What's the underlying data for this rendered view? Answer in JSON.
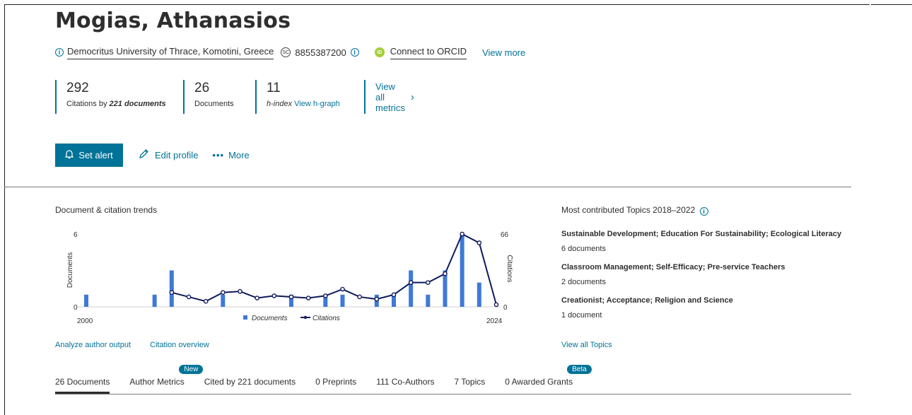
{
  "author": {
    "name": "Mogias, Athanasios",
    "affiliation": "Democritus University of Thrace, Komotini, Greece",
    "scopus_id": "8855387200",
    "orcid_label": "Connect to ORCID",
    "view_more": "View more"
  },
  "metrics": {
    "citations_value": "292",
    "citations_label_prefix": "Citations by ",
    "citations_label_bold": "221 documents",
    "documents_value": "26",
    "documents_label": "Documents",
    "hindex_value": "11",
    "hindex_label": "h-index",
    "hindex_link": "View h-graph",
    "view_all": "View all metrics"
  },
  "actions": {
    "set_alert": "Set alert",
    "edit_profile": "Edit profile",
    "more": "More"
  },
  "trends": {
    "title": "Document & citation trends",
    "analyze_link": "Analyze author output",
    "overview_link": "Citation overview"
  },
  "chart_data": {
    "type": "bar",
    "x": [
      2000,
      2001,
      2002,
      2003,
      2004,
      2005,
      2006,
      2007,
      2008,
      2009,
      2010,
      2011,
      2012,
      2013,
      2014,
      2015,
      2016,
      2017,
      2018,
      2019,
      2020,
      2021,
      2022,
      2023,
      2024
    ],
    "series": [
      {
        "name": "Documents",
        "axis": "left",
        "type": "bar",
        "values": [
          1,
          0,
          0,
          0,
          1,
          3,
          0,
          0,
          1,
          0,
          0,
          0,
          1,
          0,
          1,
          1,
          0,
          1,
          1,
          3,
          1,
          3,
          6,
          2,
          0
        ]
      },
      {
        "name": "Citations",
        "axis": "right",
        "type": "line",
        "start_year": 2005,
        "values": [
          13,
          9,
          5,
          13,
          14,
          8,
          10,
          9,
          8,
          10,
          16,
          9,
          7,
          11,
          22,
          22,
          30,
          66,
          58,
          2
        ]
      }
    ],
    "xlabel_left": "2000",
    "xlabel_right": "2024",
    "ylabel_left": "Documents",
    "ylabel_right": "Citations",
    "ylim_left": [
      0,
      6
    ],
    "ylim_right": [
      0,
      66
    ],
    "left_ticks": [
      "0",
      "6"
    ],
    "right_ticks": [
      "0",
      "66"
    ],
    "colors": {
      "documents": "#3f79d8",
      "citations": "#0f1a5c"
    }
  },
  "topics": {
    "title": "Most contributed Topics 2018–2022",
    "items": [
      {
        "title": "Sustainable Development; Education For Sustainability; Ecological Literacy",
        "count": "6 documents"
      },
      {
        "title": "Classroom Management; Self-Efficacy; Pre-service Teachers",
        "count": "2 documents"
      },
      {
        "title": "Creationist; Acceptance; Religion and Science",
        "count": "1 document"
      }
    ],
    "view_all": "View all Topics"
  },
  "tabs": {
    "items": [
      "26 Documents",
      "Author Metrics",
      "Cited by 221 documents",
      "0 Preprints",
      "111 Co-Authors",
      "7 Topics",
      "0 Awarded Grants"
    ],
    "badge_new": "New",
    "badge_beta": "Beta"
  },
  "colors": {
    "accent": "#007398",
    "orcid": "#a6ce39"
  }
}
